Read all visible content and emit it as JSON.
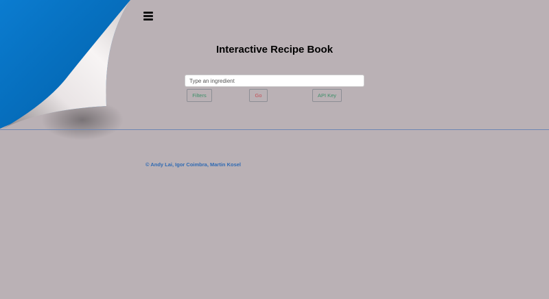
{
  "header": {
    "menu_icon": "hamburger-menu-icon",
    "title": "Interactive Recipe Book"
  },
  "search": {
    "placeholder": "Type an ingredient",
    "value": ""
  },
  "buttons": {
    "filters_label": "Filters",
    "go_label": "Go",
    "api_key_label": "API Key"
  },
  "footer": {
    "credits": "© Andy Lai, Igor Coimbra, Martin Kosel"
  },
  "colors": {
    "background": "#bab1b5",
    "curl_blue": "#0a74c4",
    "filters_text": "#3c8f68",
    "go_text": "#c54e55",
    "credits_text": "#2f6ab3",
    "divider": "#6d86b3"
  }
}
